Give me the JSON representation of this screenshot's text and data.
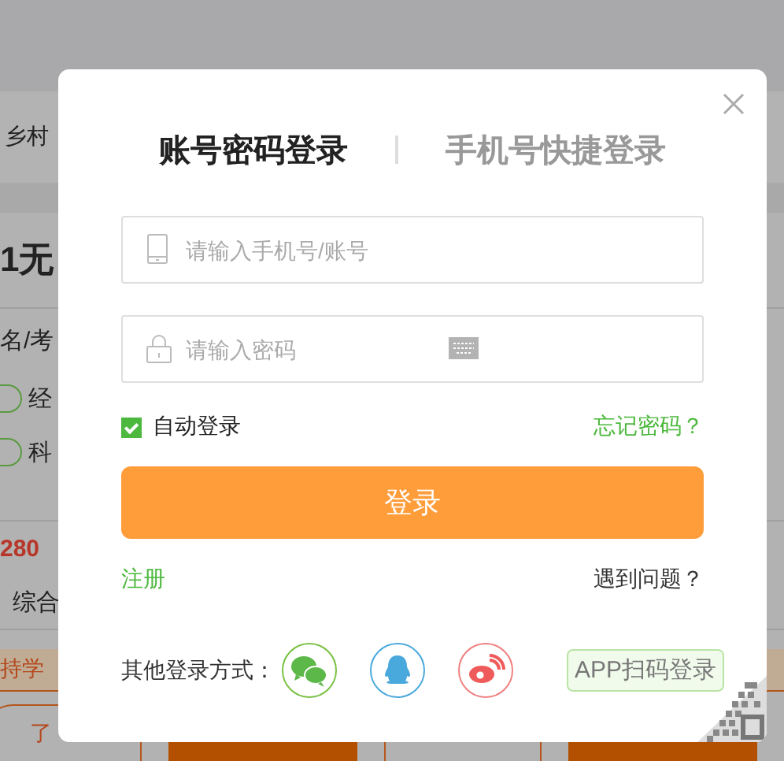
{
  "background_page": {
    "nav": {
      "left": "乡村"
    },
    "title": "1无",
    "subtitle": "名/考",
    "options": [
      {
        "label": "经"
      },
      {
        "label": "科"
      }
    ],
    "price": "280",
    "category": "综合",
    "notice": {
      "left": "持学"
    },
    "buttons": [
      {
        "label": "了",
        "kind": "outline"
      },
      {
        "kind": "filled"
      },
      {
        "kind": "outline"
      },
      {
        "kind": "filled"
      }
    ]
  },
  "dialog": {
    "tabs": [
      {
        "label": "账号密码登录",
        "selected": true
      },
      {
        "label": "手机号快捷登录",
        "selected": false
      }
    ],
    "fields": [
      {
        "kind": "phone",
        "placeholder": "请输入手机号/账号"
      },
      {
        "kind": "password",
        "placeholder": "请输入密码"
      }
    ],
    "auto_login": {
      "label": "自动登录",
      "checked": true
    },
    "forgot_link": "忘记密码？",
    "submit_button": "登录",
    "register_link": "注册",
    "help_link": "遇到问题？",
    "other_methods": {
      "label": "其他登录方式：",
      "providers": [
        {
          "kind": "wechat"
        },
        {
          "kind": "qq"
        },
        {
          "kind": "weibo"
        }
      ]
    },
    "qr_login": "APP扫码登录"
  }
}
